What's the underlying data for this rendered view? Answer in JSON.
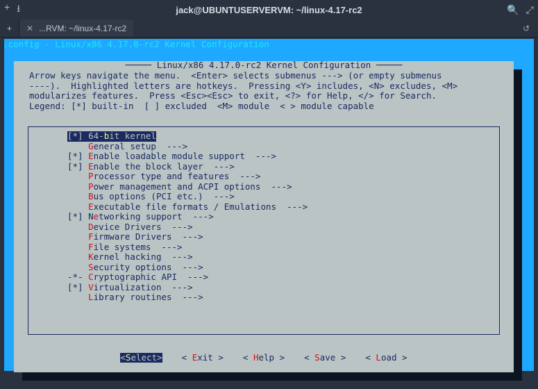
{
  "window": {
    "title": "jack@UBUNTUSERVERVM: ~/linux-4.17-rc2",
    "tab_label": "...RVM: ~/linux-4.17-rc2"
  },
  "topline": ".config - Linux/x86 4.17.0-rc2 Kernel Configuration",
  "panel": {
    "heading": " Linux/x86 4.17.0-rc2 Kernel Configuration ",
    "help_lines": [
      "Arrow keys navigate the menu.  <Enter> selects submenus ---> (or empty submenus",
      "----).  Highlighted letters are hotkeys.  Pressing <Y> includes, <N> excludes, <M>",
      "modularizes features.  Press <Esc><Esc> to exit, <?> for Help, </> for Search.",
      "Legend: [*] built-in  [ ] excluded  <M> module  < > module capable"
    ]
  },
  "menu": [
    {
      "prefix": "[*] ",
      "hot": "b",
      "before": "64-",
      "after": "it kernel",
      "suffix": "",
      "selected": true
    },
    {
      "prefix": "    ",
      "hot": "G",
      "before": "",
      "after": "eneral setup",
      "suffix": "  --->"
    },
    {
      "prefix": "[*] ",
      "hot": "E",
      "before": "",
      "after": "nable loadable module support",
      "suffix": "  --->"
    },
    {
      "prefix": "[*] ",
      "hot": "E",
      "before": "",
      "after": "nable the block layer",
      "suffix": "  --->"
    },
    {
      "prefix": "    ",
      "hot": "P",
      "before": "",
      "after": "rocessor type and features",
      "suffix": "  --->"
    },
    {
      "prefix": "    ",
      "hot": "P",
      "before": "",
      "after": "ower management and ACPI options",
      "suffix": "  --->"
    },
    {
      "prefix": "    ",
      "hot": "B",
      "before": "",
      "after": "us options (PCI etc.)",
      "suffix": "  --->"
    },
    {
      "prefix": "    ",
      "hot": "E",
      "before": "",
      "after": "xecutable file formats / Emulations",
      "suffix": "  --->"
    },
    {
      "prefix": "[*] ",
      "hot": "e",
      "before": "N",
      "after": "tworking support",
      "suffix": "  --->"
    },
    {
      "prefix": "    ",
      "hot": "D",
      "before": "",
      "after": "evice Drivers",
      "suffix": "  --->"
    },
    {
      "prefix": "    ",
      "hot": "F",
      "before": "",
      "after": "irmware Drivers",
      "suffix": "  --->"
    },
    {
      "prefix": "    ",
      "hot": "F",
      "before": "",
      "after": "ile systems",
      "suffix": "  --->"
    },
    {
      "prefix": "    ",
      "hot": "K",
      "before": "",
      "after": "ernel hacking",
      "suffix": "  --->"
    },
    {
      "prefix": "    ",
      "hot": "S",
      "before": "",
      "after": "ecurity options",
      "suffix": "  --->"
    },
    {
      "prefix": "-*- ",
      "hot": "C",
      "before": "",
      "after": "ryptographic API",
      "suffix": "  --->"
    },
    {
      "prefix": "[*] ",
      "hot": "V",
      "before": "",
      "after": "irtualization",
      "suffix": "  --->"
    },
    {
      "prefix": "    ",
      "hot": "L",
      "before": "",
      "after": "ibrary routines",
      "suffix": "  --->"
    }
  ],
  "buttons": [
    {
      "label_before": "<",
      "hot": "S",
      "label_after": "elect>",
      "selected": true
    },
    {
      "label_before": "< ",
      "hot": "E",
      "label_after": "xit >"
    },
    {
      "label_before": "< ",
      "hot": "H",
      "label_after": "elp >"
    },
    {
      "label_before": "< ",
      "hot": "S",
      "label_after": "ave >"
    },
    {
      "label_before": "< ",
      "hot": "L",
      "label_after": "oad >"
    }
  ]
}
